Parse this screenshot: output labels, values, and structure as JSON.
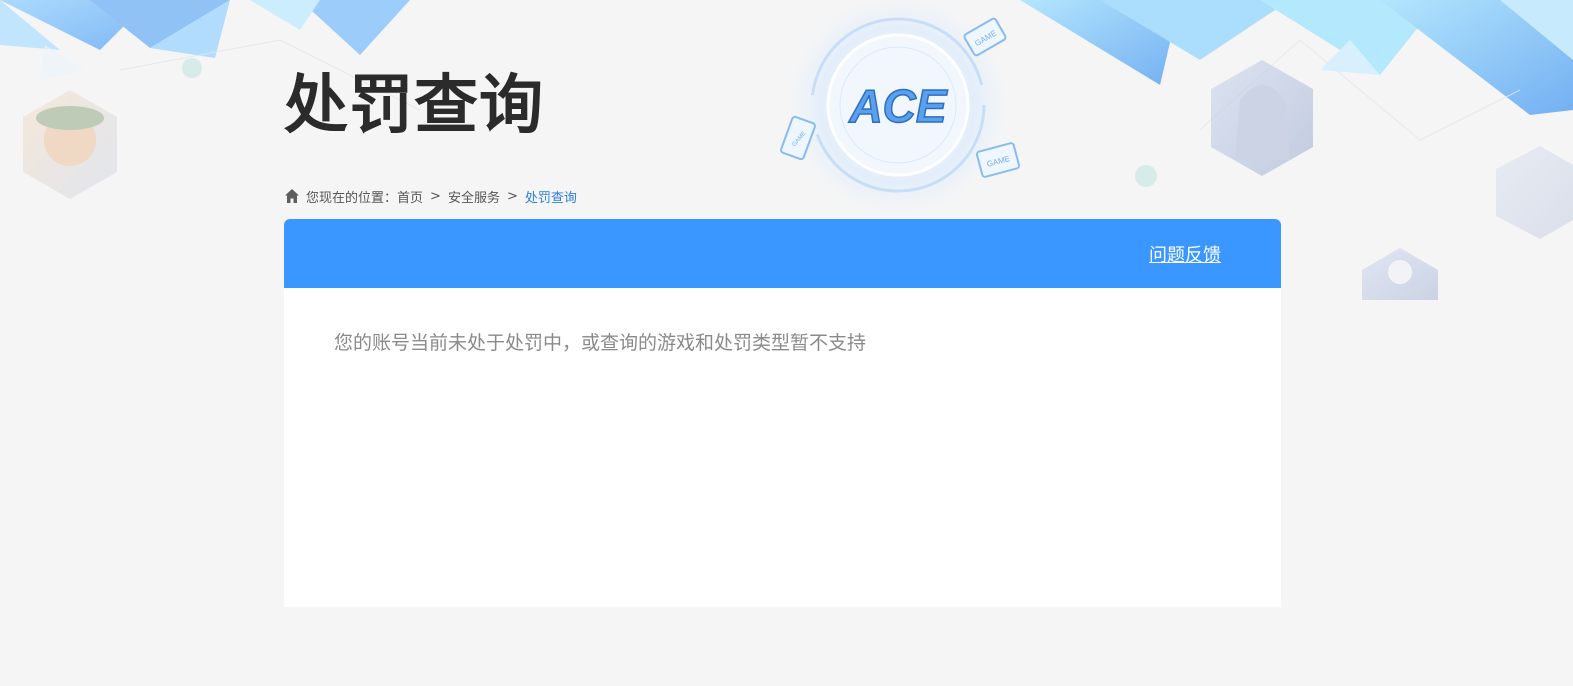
{
  "page": {
    "title": "处罚查询"
  },
  "breadcrumb": {
    "prefix": "您现在的位置：",
    "items": [
      {
        "label": "首页"
      },
      {
        "label": "安全服务"
      }
    ],
    "separator": ">",
    "current": "处罚查询"
  },
  "logo": {
    "text": "ACE",
    "badge_text": "GAME"
  },
  "panel": {
    "feedback_label": "问题反馈",
    "message": "您的账号当前未处于处罚中，或查询的游戏和处罚类型暂不支持"
  },
  "colors": {
    "header_blue": "#3a97ff",
    "breadcrumb_current": "#2f7fd8",
    "title": "#2b2b2b",
    "message": "#8a8a8a",
    "page_bg": "#f5f5f5"
  }
}
